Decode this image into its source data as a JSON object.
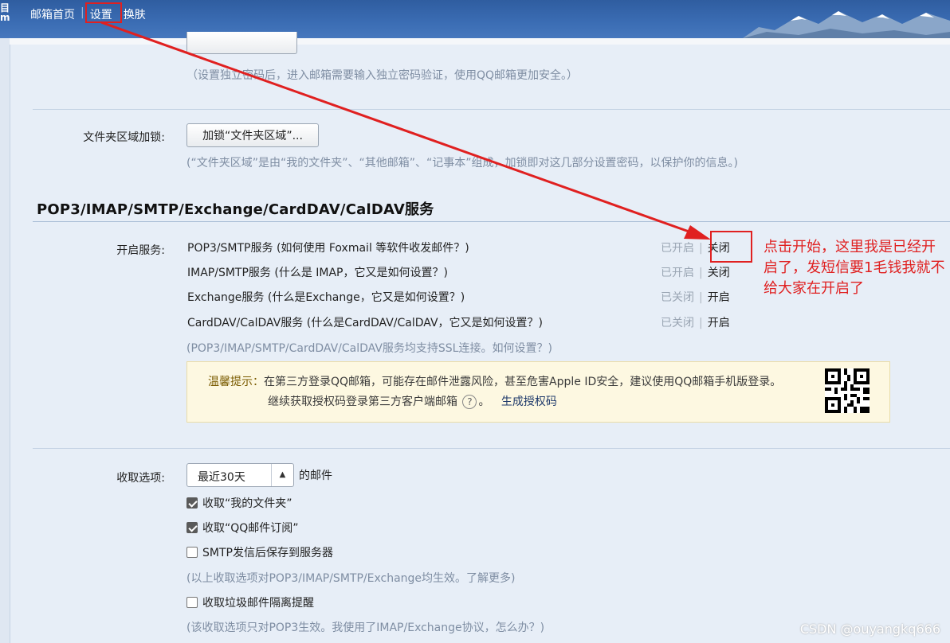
{
  "header": {
    "logo_fragment": "目\nm",
    "nav": [
      {
        "label": "邮箱首页"
      },
      {
        "label": "设置"
      },
      {
        "label": "换肤"
      }
    ]
  },
  "security": {
    "indep_password_hint": "（设置独立密码后，进入邮箱需要输入独立密码验证，使用QQ邮箱更加安全。）",
    "folder_lock_label": "文件夹区域加锁:",
    "folder_lock_button": "加锁“文件夹区域”...",
    "folder_lock_hint": "(“文件夹区域”是由“我的文件夹”、“其他邮箱”、“记事本”组成，加锁即对这几部分设置密码，以保护你的信息。)"
  },
  "protocols": {
    "section_title": "POP3/IMAP/SMTP/Exchange/CardDAV/CalDAV服务",
    "enable_label": "开启服务:",
    "services": [
      {
        "name": "POP3/SMTP服务",
        "help": "(如何使用 Foxmail 等软件收发邮件？)",
        "state": "已开启",
        "action": "关闭"
      },
      {
        "name": "IMAP/SMTP服务",
        "help": "(什么是 IMAP，它又是如何设置？)",
        "state": "已开启",
        "action": "关闭"
      },
      {
        "name": "Exchange服务",
        "help": "(什么是Exchange，它又是如何设置？)",
        "state": "已关闭",
        "action": "开启"
      },
      {
        "name": "CardDAV/CalDAV服务",
        "help": "(什么是CardDAV/CalDAV，它又是如何设置？)",
        "state": "已关闭",
        "action": "开启"
      }
    ],
    "ssl_hint": "(POP3/IMAP/SMTP/CardDAV/CalDAV服务均支持SSL连接。如何设置？)",
    "warning": {
      "prefix": "温馨提示：",
      "text1": "在第三方登录QQ邮箱，可能存在邮件泄露风险，甚至危害Apple ID安全，建议使用QQ邮箱手机版登录。",
      "text2": "继续获取授权码登录第三方客户端邮箱",
      "qmark": "?",
      "text2_end": "。",
      "generate_link": "生成授权码"
    }
  },
  "receive": {
    "label": "收取选项:",
    "range_value": "最近30天",
    "range_suffix": "的邮件",
    "options": [
      {
        "label": "收取“我的文件夹”",
        "checked": true
      },
      {
        "label": "收取“QQ邮件订阅”",
        "checked": true
      },
      {
        "label": "SMTP发信后保存到服务器",
        "checked": false
      }
    ],
    "options_hint": "(以上收取选项对POP3/IMAP/SMTP/Exchange均生效。了解更多)",
    "spam_option": {
      "label": "收取垃圾邮件隔离提醒",
      "checked": false
    },
    "spam_hint": "(该收取选项只对POP3生效。我使用了IMAP/Exchange协议，怎么办？)"
  },
  "annotation": {
    "text": "点击开始，这里我是已经开启了，发短信要1毛钱我就不给大家在开启了",
    "color": "#e02020"
  },
  "watermark": "CSDN @ouyangkq666"
}
